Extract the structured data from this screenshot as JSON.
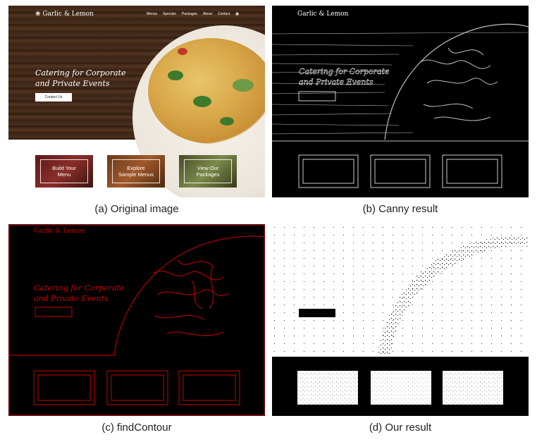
{
  "site": {
    "logo": "Garlic & Lemon",
    "nav": [
      "Menus",
      "Specials",
      "Packages",
      "About",
      "Contact"
    ],
    "headline_line1": "Catering for Corporate",
    "headline_line2": "and Private Events",
    "cta": "Contact Us",
    "tiles": [
      {
        "line1": "Build Your",
        "line2": "Menu"
      },
      {
        "line1": "Explore",
        "line2": "Sample Menus"
      },
      {
        "line1": "View Our",
        "line2": "Packages"
      }
    ]
  },
  "captions": {
    "a": "(a) Original image",
    "b": "(b) Canny result",
    "c": "(c) findContour",
    "d": "(d) Our result"
  },
  "colors": {
    "canny_edge": "#ffffff",
    "contour_edge": "#cc0000",
    "ours_ink": "#000000"
  }
}
